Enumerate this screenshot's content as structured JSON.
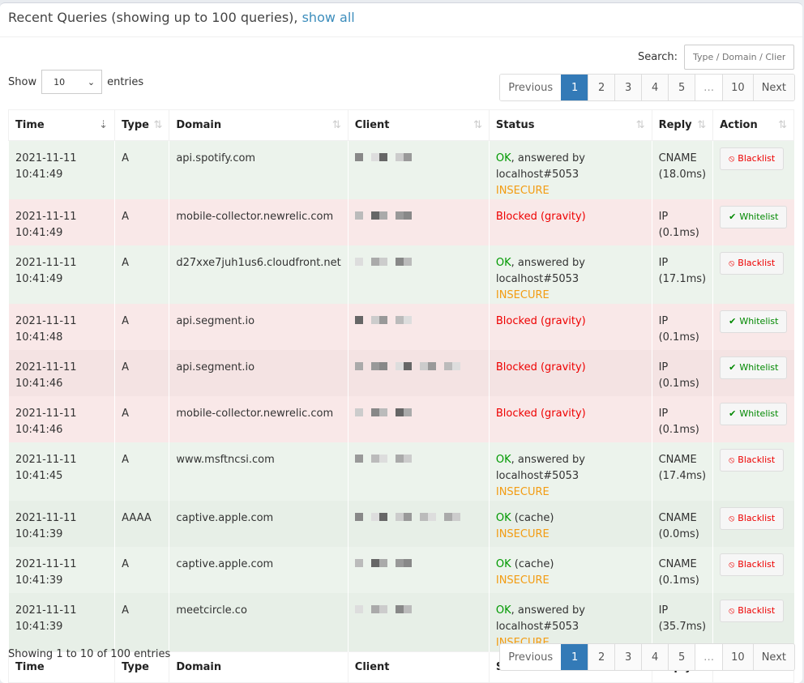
{
  "header": {
    "title": "Recent Queries (showing up to 100 queries),",
    "show_all": "show all"
  },
  "search": {
    "label": "Search:",
    "placeholder": "Type / Domain / Client"
  },
  "length": {
    "show": "Show",
    "value": "10",
    "entries": "entries"
  },
  "pager": {
    "previous": "Previous",
    "pages": [
      "1",
      "2",
      "3",
      "4",
      "5",
      "…",
      "10"
    ],
    "next": "Next",
    "active": "1"
  },
  "columns": [
    "Time",
    "Type",
    "Domain",
    "Client",
    "Status",
    "Reply",
    "Action"
  ],
  "rows": [
    {
      "time": "2021-11-11 10:41:49",
      "type": "A",
      "domain": "api.spotify.com",
      "status_ok": "OK",
      "status_rest": ", answered by localhost#5053",
      "dnssec": "INSECURE",
      "reply": "CNAME",
      "reply_time": "(18.0ms)",
      "action": "Blacklist",
      "kind": "ok"
    },
    {
      "time": "2021-11-11 10:41:49",
      "type": "A",
      "domain": "mobile-collector.newrelic.com",
      "status_blocked": "Blocked (gravity)",
      "reply": "IP",
      "reply_time": "(0.1ms)",
      "action": "Whitelist",
      "kind": "bl"
    },
    {
      "time": "2021-11-11 10:41:49",
      "type": "A",
      "domain": "d27xxe7juh1us6.cloudfront.net",
      "status_ok": "OK",
      "status_rest": ", answered by localhost#5053",
      "dnssec": "INSECURE",
      "reply": "IP",
      "reply_time": "(17.1ms)",
      "action": "Blacklist",
      "kind": "ok"
    },
    {
      "time": "2021-11-11 10:41:48",
      "type": "A",
      "domain": "api.segment.io",
      "status_blocked": "Blocked (gravity)",
      "reply": "IP",
      "reply_time": "(0.1ms)",
      "action": "Whitelist",
      "kind": "bl"
    },
    {
      "time": "2021-11-11 10:41:46",
      "type": "A",
      "domain": "api.segment.io",
      "status_blocked": "Blocked (gravity)",
      "reply": "IP",
      "reply_time": "(0.1ms)",
      "action": "Whitelist",
      "kind": "bl"
    },
    {
      "time": "2021-11-11 10:41:46",
      "type": "A",
      "domain": "mobile-collector.newrelic.com",
      "status_blocked": "Blocked (gravity)",
      "reply": "IP",
      "reply_time": "(0.1ms)",
      "action": "Whitelist",
      "kind": "bl"
    },
    {
      "time": "2021-11-11 10:41:45",
      "type": "A",
      "domain": "www.msftncsi.com",
      "status_ok": "OK",
      "status_rest": ", answered by localhost#5053",
      "dnssec": "INSECURE",
      "reply": "CNAME",
      "reply_time": "(17.4ms)",
      "action": "Blacklist",
      "kind": "ok"
    },
    {
      "time": "2021-11-11 10:41:39",
      "type": "AAAA",
      "domain": "captive.apple.com",
      "status_ok": "OK",
      "status_rest": " (cache)",
      "dnssec": "INSECURE",
      "reply": "CNAME",
      "reply_time": "(0.0ms)",
      "action": "Blacklist",
      "kind": "ok"
    },
    {
      "time": "2021-11-11 10:41:39",
      "type": "A",
      "domain": "captive.apple.com",
      "status_ok": "OK",
      "status_rest": " (cache)",
      "dnssec": "INSECURE",
      "reply": "CNAME",
      "reply_time": "(0.1ms)",
      "action": "Blacklist",
      "kind": "ok"
    },
    {
      "time": "2021-11-11 10:41:39",
      "type": "A",
      "domain": "meetcircle.co",
      "status_ok": "OK",
      "status_rest": ", answered by localhost#5053",
      "dnssec": "INSECURE",
      "reply": "IP",
      "reply_time": "(35.7ms)",
      "action": "Blacklist",
      "kind": "ok"
    }
  ],
  "footer": {
    "info": "Showing 1 to 10 of 100 entries"
  }
}
